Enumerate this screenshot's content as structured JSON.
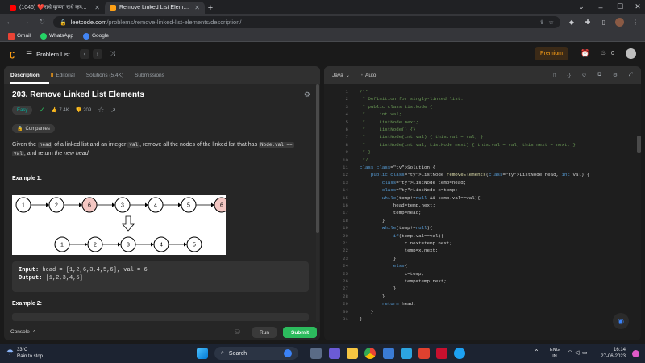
{
  "browser": {
    "tabs": [
      {
        "title": "(1046) ❤️राधे कृष्णा राधे कृष्णा राधे",
        "favicon_color": "#ff0000",
        "active": false
      },
      {
        "title": "Remove Linked List Elements - LeetCode",
        "favicon_color": "#ffa116",
        "active": true
      }
    ],
    "new_tab": "+",
    "url_domain": "leetcode.com",
    "url_path": "/problems/remove-linked-list-elements/description/",
    "bookmarks": [
      {
        "label": "Gmail",
        "color": "#ea4335"
      },
      {
        "label": "WhatsApp",
        "color": "#25d366"
      },
      {
        "label": "Google",
        "color": "#4285f4"
      }
    ]
  },
  "header": {
    "problem_list": "Problem List",
    "premium": "Premium",
    "streak_count": "0"
  },
  "left_panel": {
    "tabs": [
      "Description",
      "Editorial",
      "Solutions (5.4K)",
      "Submissions"
    ],
    "title": "203. Remove Linked List Elements",
    "difficulty": "Easy",
    "likes": "7.4K",
    "dislikes": "209",
    "companies": "Companies",
    "statement": {
      "p1": "Given the ",
      "c1": "head",
      "p2": " of a linked list and an integer ",
      "c2": "val",
      "p3": ", remove all the nodes of the linked list that has ",
      "c3": "Node.val ==",
      "c4": "val",
      "p4": ", and return ",
      "em": "the new head",
      "p5": "."
    },
    "example1_title": "Example 1:",
    "example1_input_label": "Input:",
    "example1_input": "head = [1,2,6,3,4,5,6], val = 6",
    "example1_output_label": "Output:",
    "example1_output": "[1,2,3,4,5]",
    "example2_title": "Example 2:",
    "diagram": {
      "top_nodes": [
        "1",
        "2",
        "6",
        "3",
        "4",
        "5",
        "6"
      ],
      "top_removed": [
        false,
        false,
        true,
        false,
        false,
        false,
        true
      ],
      "bottom_nodes": [
        "1",
        "2",
        "3",
        "4",
        "5"
      ]
    },
    "console": "Console",
    "run": "Run",
    "submit": "Submit"
  },
  "right_panel": {
    "language": "Java",
    "autocomplete": "Auto",
    "lines": [
      {
        "n": "1",
        "t": "/**",
        "c": "cm"
      },
      {
        "n": "2",
        "t": " * Definition for singly-linked list.",
        "c": "cm"
      },
      {
        "n": "3",
        "t": " * public class ListNode {",
        "c": "cm"
      },
      {
        "n": "4",
        "t": " *     int val;",
        "c": "cm"
      },
      {
        "n": "5",
        "t": " *     ListNode next;",
        "c": "cm"
      },
      {
        "n": "6",
        "t": " *     ListNode() {}",
        "c": "cm"
      },
      {
        "n": "7",
        "t": " *     ListNode(int val) { this.val = val; }",
        "c": "cm"
      },
      {
        "n": "8",
        "t": " *     ListNode(int val, ListNode next) { this.val = val; this.next = next; }",
        "c": "cm"
      },
      {
        "n": "9",
        "t": " * }",
        "c": "cm"
      },
      {
        "n": "10",
        "t": " */",
        "c": "cm"
      },
      {
        "n": "11",
        "t": "class Solution {",
        "c": ""
      },
      {
        "n": "12",
        "t": "    public ListNode removeElements(ListNode head, int val) {",
        "c": ""
      },
      {
        "n": "13",
        "t": "        ListNode temp=head;",
        "c": ""
      },
      {
        "n": "14",
        "t": "        ListNode x=temp;",
        "c": ""
      },
      {
        "n": "15",
        "t": "        while(temp!=null && temp.val==val){",
        "c": ""
      },
      {
        "n": "16",
        "t": "            head=temp.next;",
        "c": ""
      },
      {
        "n": "17",
        "t": "            temp=head;",
        "c": ""
      },
      {
        "n": "18",
        "t": "        }",
        "c": ""
      },
      {
        "n": "19",
        "t": "        while(temp!=null){",
        "c": ""
      },
      {
        "n": "20",
        "t": "            if(temp.val==val){",
        "c": ""
      },
      {
        "n": "21",
        "t": "                x.next=temp.next;",
        "c": ""
      },
      {
        "n": "22",
        "t": "                temp=x.next;",
        "c": ""
      },
      {
        "n": "23",
        "t": "            }",
        "c": ""
      },
      {
        "n": "24",
        "t": "            else{",
        "c": ""
      },
      {
        "n": "25",
        "t": "                x=temp;",
        "c": ""
      },
      {
        "n": "26",
        "t": "                temp=temp.next;",
        "c": ""
      },
      {
        "n": "27",
        "t": "            }",
        "c": ""
      },
      {
        "n": "28",
        "t": "        }",
        "c": ""
      },
      {
        "n": "29",
        "t": "        return head;",
        "c": ""
      },
      {
        "n": "30",
        "t": "    }",
        "c": ""
      },
      {
        "n": "31",
        "t": "}",
        "c": ""
      }
    ]
  },
  "taskbar": {
    "temperature": "33°C",
    "weather": "Rain to stop",
    "search": "Search",
    "lang1": "ENG",
    "lang2": "IN",
    "time": "16:14",
    "date": "27-06-2023"
  }
}
